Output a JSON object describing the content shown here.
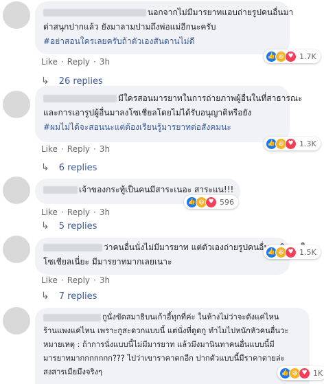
{
  "comments": [
    {
      "lines": [
        "นอกจากไม่มีมารยาทแอบถ่ายรูปคนอื่นมา",
        "ด่าสนุกปากแล้ว ยังมาลามปามถึงพ่อแม่อีกนะครับ"
      ],
      "hashtag": "#อย่าสอนใครเลยครับถ้าตัวเองสันดานไม่ดี",
      "reaction_count": "1.7K",
      "like": "Like",
      "reply": "Reply",
      "time": "3h",
      "replies": "26 replies"
    },
    {
      "lines": [
        "มีใครสอนมารยาทในการถ่ายภาพผู้อื่นในที่สาธารณะ",
        "และการเอารูปผู้อื่นมาลงโซเชียลโดยไม่ได้รับอนุญาติหรือยัง"
      ],
      "hashtag": "#ผมไม่ได้จะสอนนะแต่ต้องเรียนรู้มารยาทต่อสังคมนะ",
      "reaction_count": "1.3K",
      "like": "Like",
      "reply": "Reply",
      "time": "3h",
      "replies": "6 replies"
    },
    {
      "lines": [
        "เจ้าของกระทู้เป็นคนมีสาระเนอะ สาระแน!!!"
      ],
      "reaction_count": "596",
      "like": "Like",
      "reply": "Reply",
      "time": "3h",
      "replies": "5 replies"
    },
    {
      "lines": [
        "ว่าคนอื่นนั่งไม่มีมารยาท แต่ตัวเองถ่ายรูปคนอื่นมานินทาใน",
        "โซเชียลเนี่ยะ มีมารยาทมากเลยเนาะ"
      ],
      "reaction_count": "1.5K",
      "like": "Like",
      "reply": "Reply",
      "time": "3h",
      "replies": "7 replies"
    },
    {
      "lines": [
        "กูนั่งขัดสมาธิบนเก้าอี้ทุกที่ค่ะ ในห้างไม่ว่าจะดังแค่ไหน",
        "ร้านแพงแค่ไหน เพราะกูสะดวกแบบนี้ แต่นั่งที่ดูดกู ทำไมไปหนักหัวคนอื่นวะ",
        "หมายเหตุ : ถ้าการนั่งแบบนี้ไม่มีมารยาท แล้วมึงมานินทาคนอื่นแบบนี้มี",
        "มารยาทมากกกกกกก??? ไปว่าเขาราคาตกอีก ปากตัวแบบนี้มีราคาตายล่ะ",
        "สงสารเมียมึงจริงๆ"
      ],
      "reaction_count": "1K"
    }
  ]
}
